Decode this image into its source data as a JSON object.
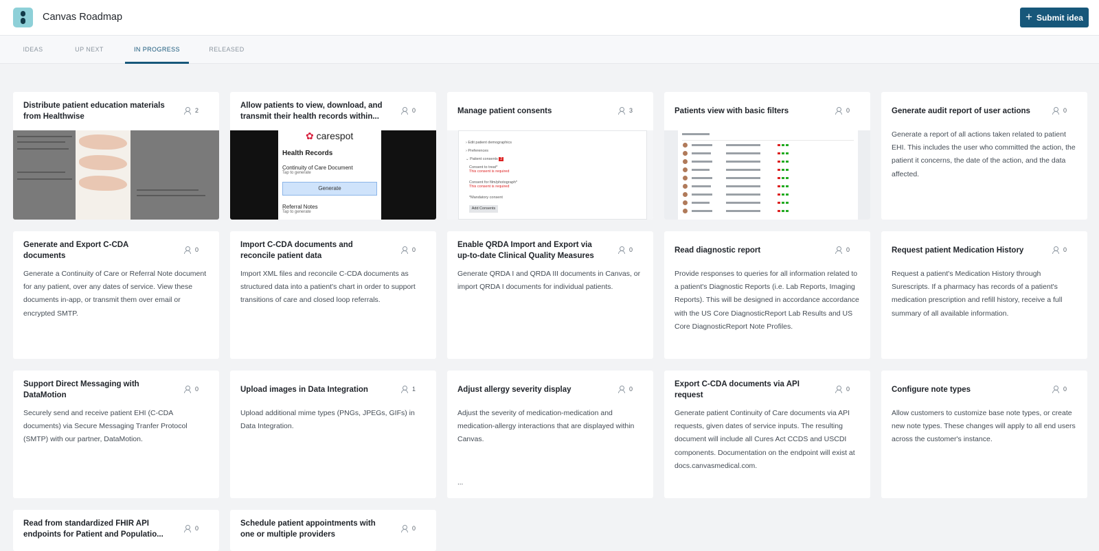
{
  "app": {
    "title": "Canvas Roadmap",
    "submit_label": "Submit idea"
  },
  "tabs": [
    {
      "label": "IDEAS",
      "active": false
    },
    {
      "label": "UP NEXT",
      "active": false
    },
    {
      "label": "IN PROGRESS",
      "active": true
    },
    {
      "label": "RELEASED",
      "active": false
    }
  ],
  "colors": {
    "accent": "#17577a",
    "background": "#f2f3f5",
    "card": "#ffffff"
  },
  "cards": [
    {
      "title": "Distribute patient education materials from Healthwise",
      "votes": "2",
      "thumbnail": "healthwise-education-sheet"
    },
    {
      "title": "Allow patients to view, download, and transmit their health records within...",
      "votes": "0",
      "thumbnail": "carespot-health-records"
    },
    {
      "title": "Manage patient consents",
      "votes": "3",
      "thumbnail": "patient-consents-form"
    },
    {
      "title": "Patients view with basic filters",
      "votes": "0",
      "thumbnail": "patients-list-table"
    },
    {
      "title": "Generate audit report of user actions",
      "votes": "0",
      "description": "Generate a report of all actions taken related to patient EHI. This includes the user who committed the action, the patient it concerns, the date of the action, and the data affected."
    },
    {
      "title": "Generate and Export C-CDA documents",
      "votes": "0",
      "description": "Generate a Continuity of Care or Referral Note document for any patient, over any dates of service. View these documents in-app, or transmit them over email or encrypted SMTP."
    },
    {
      "title": "Import C-CDA documents and reconcile patient data",
      "votes": "0",
      "description": "Import XML files and reconcile C-CDA documents as structured data into a patient's chart in order to support transitions of care and closed loop referrals."
    },
    {
      "title": "Enable QRDA Import and Export via up-to-date Clinical Quality Measures",
      "votes": "0",
      "description": "Generate QRDA I and QRDA III documents in Canvas, or import QRDA I documents for individual patients."
    },
    {
      "title": "Read diagnostic report",
      "votes": "0",
      "description": "Provide responses to queries for all information related to a patient's Diagnostic Reports (i.e. Lab Reports, Imaging Reports). This will be designed in accordance accordance with the US Core DiagnosticReport Lab Results and US Core DiagnosticReport Note Profiles."
    },
    {
      "title": "Request patient Medication History",
      "votes": "0",
      "description": "Request a patient's Medication History through Surescripts. If a pharmacy has records of a patient's medication prescription and refill history, receive a full summary of all available information."
    },
    {
      "title": "Support Direct Messaging with DataMotion",
      "votes": "0",
      "description": "Securely send and receive patient EHI (C-CDA documents) via Secure Messaging Tranfer Protocol (SMTP) with our partner, DataMotion."
    },
    {
      "title": "Upload images in Data Integration",
      "votes": "1",
      "description": "Upload additional mime types (PNGs, JPEGs, GIFs) in Data Integration."
    },
    {
      "title": "Adjust allergy severity display",
      "votes": "0",
      "description": "Adjust the severity of medication-medication and medication-allergy interactions that are displayed within Canvas.",
      "more": "..."
    },
    {
      "title": "Export C-CDA documents via API request",
      "votes": "0",
      "description": "Generate patient Continuity of Care documents via API requests, given dates of service inputs. The resulting document will include all Cures Act CCDS and USCDI components. Documentation on the endpoint will exist at docs.canvasmedical.com."
    },
    {
      "title": "Configure note types",
      "votes": "0",
      "description": "Allow customers to customize base note types, or create new note types. These changes will apply to all end users across the customer's instance."
    },
    {
      "title": "Read from standardized FHIR API endpoints for Patient and Populatio...",
      "votes": "0"
    },
    {
      "title": "Schedule patient appointments with one or multiple providers",
      "votes": "0"
    }
  ],
  "thumbnails": {
    "carespot": {
      "brand": "carespot",
      "heading": "Health Records",
      "row1": "Continuity of Care Document",
      "row1_sub": "Tap to generate",
      "generate": "Generate",
      "row2": "Referral Notes",
      "row2_sub": "Tap to generate"
    },
    "consents": {
      "l1": "Edit patient demographics",
      "l2": "Preferences",
      "l3": "Patient consents",
      "l3_count": "2",
      "l4": "Consent to treat*",
      "l4_sub": "This consent is required",
      "l5": "Consent for film/photograph*",
      "l5_sub": "This consent is required",
      "l6": "*Mandatory consent",
      "button": "Add Consents"
    }
  }
}
